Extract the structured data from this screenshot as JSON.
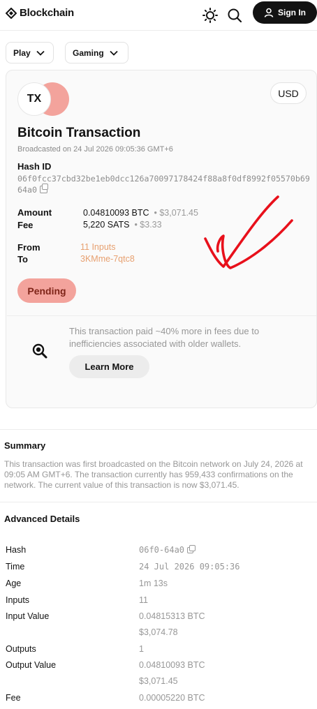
{
  "header": {
    "brand": "Blockchain",
    "icons": [
      "sun-icon",
      "search-icon"
    ],
    "signin_label": "Sign In"
  },
  "filters": [
    {
      "label": "Play"
    },
    {
      "label": "Gaming"
    }
  ],
  "transaction": {
    "icon_text": "TX",
    "currency": "USD",
    "title": "Bitcoin Transaction",
    "broadcast_text": "Broadcasted on 24 Jul 2026 09:05:36 GMT+6",
    "hash_label": "Hash ID",
    "hash_value": "06f0fcc37cbd32be1eb0dcc126a70097178424f88a8f0df8992f05570b6964a0",
    "amount_label": "Amount",
    "amount_btc": "0.04810093 BTC",
    "amount_usd": "$3,071.45",
    "fee_label": "Fee",
    "fee_sats": "5,220 SATS",
    "fee_usd": "$3.33",
    "from_label": "From",
    "from_value": "11 Inputs",
    "to_label": "To",
    "to_value": "3KMme-7qtc8",
    "status": "Pending",
    "status_color": "#f3a39c",
    "accent_color": "#e7a070",
    "note_text": "This transaction paid ~40% more in fees due to inefficiencies associated with older wallets.",
    "learn_more_label": "Learn More"
  },
  "summary": {
    "title": "Summary",
    "text": "This transaction was first broadcasted on the Bitcoin network on July 24, 2026 at 09:05 AM GMT+6. The transaction currently has 959,433 confirmations on the network. The current value of this transaction is now $3,071.45."
  },
  "advanced": {
    "title": "Advanced Details",
    "hash": {
      "label": "Hash",
      "value": "06f0-64a0"
    },
    "time": {
      "label": "Time",
      "value": "24 Jul 2026 09:05:36"
    },
    "age": {
      "label": "Age",
      "value": "1m 13s"
    },
    "inputs": {
      "label": "Inputs",
      "value": "11"
    },
    "input_value": {
      "label": "Input Value",
      "btc": "0.04815313 BTC",
      "usd": "$3,074.78"
    },
    "outputs": {
      "label": "Outputs",
      "value": "1"
    },
    "output_value": {
      "label": "Output Value",
      "btc": "0.04810093 BTC",
      "usd": "$3,071.45"
    },
    "fee": {
      "label": "Fee",
      "value": "0.00005220 BTC"
    }
  },
  "annotation": {
    "icon": "checkmark-annotation",
    "color": "#e8101b"
  }
}
